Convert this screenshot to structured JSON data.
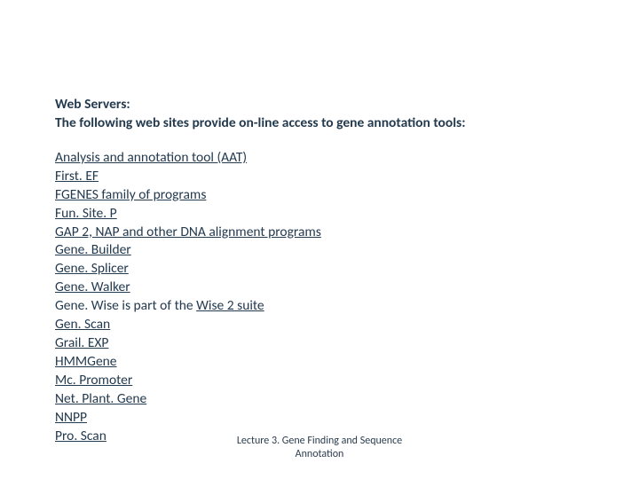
{
  "heading": {
    "line1": "Web Servers:",
    "line2": "The following web sites provide on-line access to gene annotation tools:"
  },
  "items": [
    {
      "prefix": "",
      "link": "Analysis and annotation tool (AAT)",
      "suffix": ""
    },
    {
      "prefix": "",
      "link": "First. EF",
      "suffix": ""
    },
    {
      "prefix": "",
      "link": "FGENES family of programs",
      "suffix": ""
    },
    {
      "prefix": "",
      "link": "Fun. Site. P",
      "suffix": ""
    },
    {
      "prefix": "",
      "link": "GAP 2, NAP and other DNA alignment programs",
      "suffix": ""
    },
    {
      "prefix": "",
      "link": "Gene. Builder",
      "suffix": ""
    },
    {
      "prefix": "",
      "link": "Gene. Splicer",
      "suffix": ""
    },
    {
      "prefix": "",
      "link": "Gene. Walker",
      "suffix": ""
    },
    {
      "prefix": "Gene. Wise is part of the ",
      "link": "Wise 2 suite",
      "suffix": ""
    },
    {
      "prefix": "",
      "link": "Gen. Scan",
      "suffix": ""
    },
    {
      "prefix": "",
      "link": "Grail. EXP",
      "suffix": ""
    },
    {
      "prefix": "",
      "link": "HMMGene",
      "suffix": ""
    },
    {
      "prefix": "",
      "link": "Mc. Promoter",
      "suffix": ""
    },
    {
      "prefix": "",
      "link": "Net. Plant. Gene",
      "suffix": ""
    },
    {
      "prefix": "",
      "link": "NNPP",
      "suffix": ""
    },
    {
      "prefix": "",
      "link": "Pro. Scan",
      "suffix": ""
    }
  ],
  "footer": {
    "line1": "Lecture 3. Gene Finding and Sequence",
    "line2": "Annotation"
  }
}
